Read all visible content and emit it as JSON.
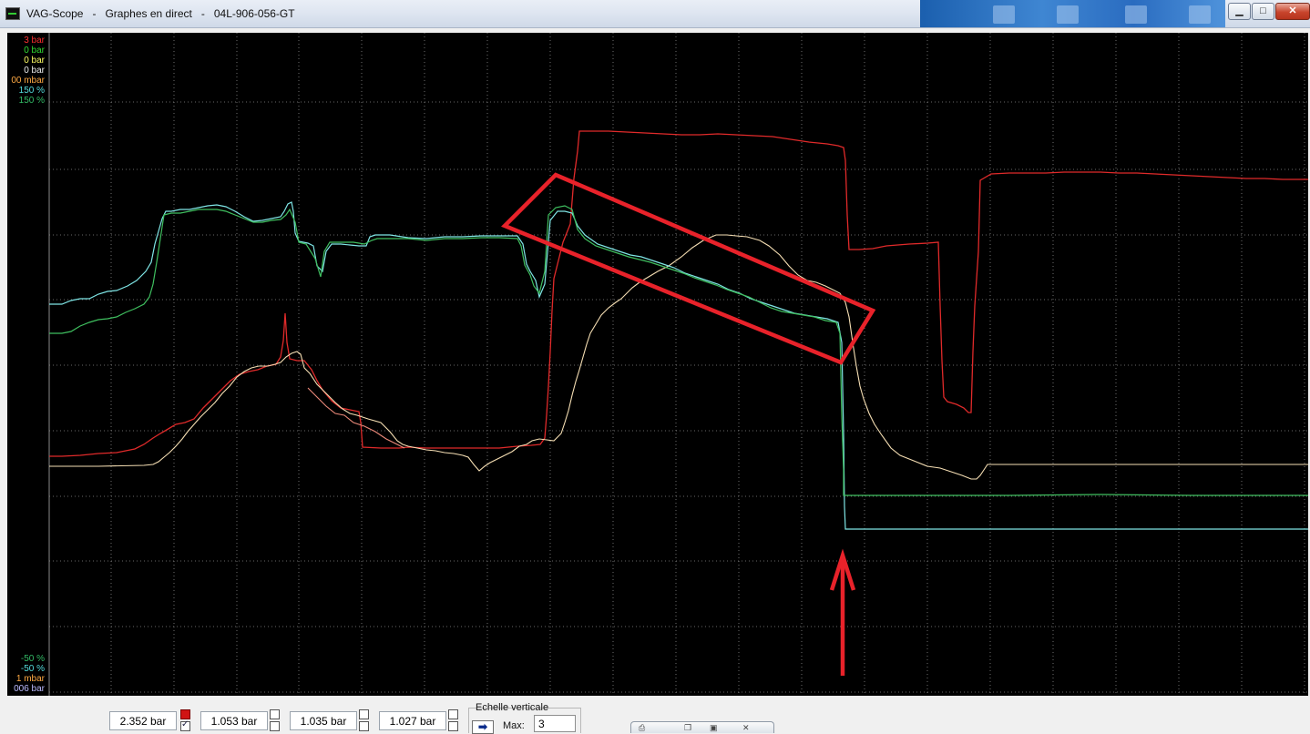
{
  "window": {
    "title": "VAG-Scope   -   Graphes en direct   -   04L-906-056-GT",
    "controls": [
      "minimize-icon",
      "maximize-icon",
      "close-icon"
    ]
  },
  "scope": {
    "background": "#000000",
    "grid_color": "#8a8a8a",
    "top_labels": [
      {
        "text": "3 bar",
        "color": "#ff3030"
      },
      {
        "text": "0 bar",
        "color": "#33dd33"
      },
      {
        "text": "0 bar",
        "color": "#ffff66"
      },
      {
        "text": "0 bar",
        "color": "#eeeeee"
      },
      {
        "text": "00 mbar",
        "color": "#ffaa44"
      },
      {
        "text": "150 %",
        "color": "#55dddd"
      },
      {
        "text": "150 %",
        "color": "#33bb66"
      }
    ],
    "bottom_labels": [
      {
        "text": "-50 %",
        "color": "#33bb66"
      },
      {
        "text": "-50 %",
        "color": "#55dddd"
      },
      {
        "text": "1 mbar",
        "color": "#ffaa44"
      },
      {
        "text": "006 bar",
        "color": "#bbbbff"
      }
    ],
    "series_colors": {
      "red": "#e02a2a",
      "cream": "#f5deb3",
      "salmon": "#ec8a7a",
      "cyan": "#7fe6e6",
      "green": "#3fbf5f"
    },
    "annotation_color": "#e8222a"
  },
  "bottom": {
    "values": [
      "2.352 bar",
      "1.053 bar",
      "1.035 bar",
      "1.027 bar"
    ],
    "vertical_scale": {
      "title": "Echelle verticale",
      "max_label": "Max:",
      "max_value": "3"
    },
    "mini_toolbar_icons": [
      "print-icon",
      "copy-icon",
      "save-icon",
      "close-icon"
    ]
  }
}
